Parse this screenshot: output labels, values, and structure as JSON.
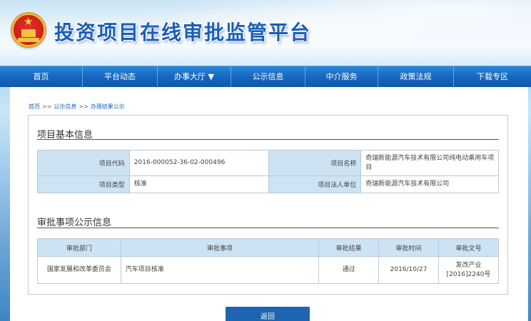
{
  "header": {
    "site_title": "投资项目在线审批监管平台"
  },
  "nav": {
    "items": [
      {
        "label": "首页"
      },
      {
        "label": "平台动态"
      },
      {
        "label": "办事大厅 ▼"
      },
      {
        "label": "公示信息"
      },
      {
        "label": "中介服务"
      },
      {
        "label": "政策法规"
      },
      {
        "label": "下载专区"
      }
    ]
  },
  "breadcrumb": {
    "items": [
      "首页",
      "公示信息",
      "办理结果公示"
    ],
    "separator": ">>"
  },
  "project_info": {
    "title": "项目基本信息",
    "code_label": "项目代码",
    "code_value": "2016-000052-36-02-000496",
    "name_label": "项目名称",
    "name_value": "奇瑞新能源汽车技术有限公司纯电动乘用车项目",
    "type_label": "项目类型",
    "type_value": "核准",
    "legal_label": "项目法人单位",
    "legal_value": "奇瑞新能源汽车技术有限公司"
  },
  "approval": {
    "title": "审批事项公示信息",
    "columns": [
      "审批部门",
      "审批事项",
      "审批结果",
      "审批时间",
      "审批文号"
    ],
    "rows": [
      {
        "dept": "国家发展和改革委员会",
        "matter": "汽车项目核准",
        "result": "通过",
        "date": "2016/10/27",
        "doc_no": "发改产业[2016]2240号"
      }
    ]
  },
  "back_button": {
    "label": "返回"
  }
}
